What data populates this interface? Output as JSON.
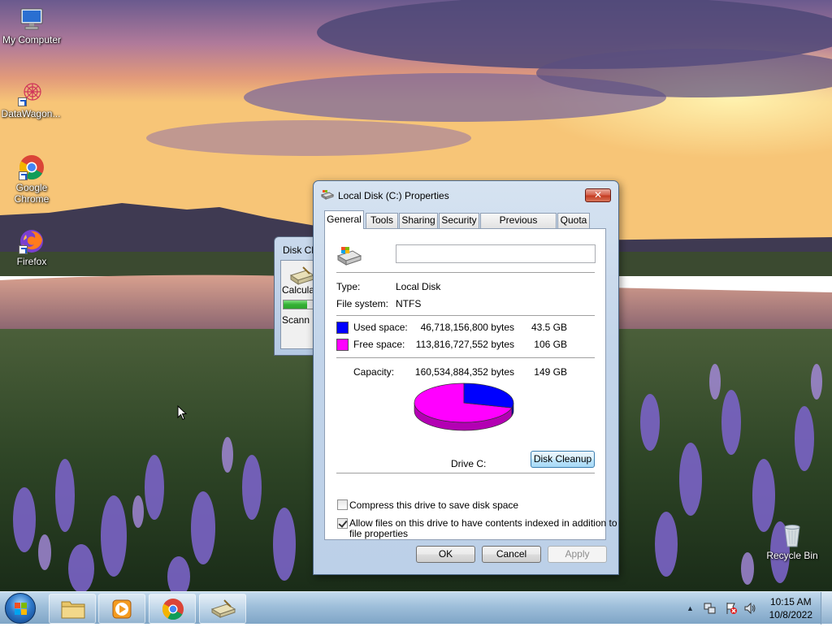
{
  "desktop": {
    "icons": [
      {
        "label": "My Computer"
      },
      {
        "label": "DataWagon..."
      },
      {
        "label": "Google Chrome"
      },
      {
        "label": "Firefox"
      },
      {
        "label": "Recycle Bin"
      }
    ]
  },
  "background_window": {
    "title": "Disk Cl",
    "status": "Calcula",
    "scan": "Scann",
    "progress_percent": 50
  },
  "dialog": {
    "title": "Local Disk (C:) Properties",
    "close_label": "✕",
    "tabs": [
      {
        "label": "General",
        "active": true
      },
      {
        "label": "Tools"
      },
      {
        "label": "Sharing"
      },
      {
        "label": "Security"
      },
      {
        "label": "Previous Versions"
      },
      {
        "label": "Quota"
      }
    ],
    "drive_name_value": "",
    "type_label": "Type:",
    "type_value": "Local Disk",
    "fs_label": "File system:",
    "fs_value": "NTFS",
    "used": {
      "label": "Used space:",
      "bytes": "46,718,156,800 bytes",
      "size": "43.5 GB",
      "color": "#0000ff"
    },
    "free": {
      "label": "Free space:",
      "bytes": "113,816,727,552 bytes",
      "size": "106 GB",
      "color": "#ff00ff"
    },
    "capacity": {
      "label": "Capacity:",
      "bytes": "160,534,884,352 bytes",
      "size": "149 GB"
    },
    "drive_label": "Drive C:",
    "cleanup_button": "Disk Cleanup",
    "compress_label": "Compress this drive to save disk space",
    "compress_checked": false,
    "index_label_line1": "Allow files on this drive to have contents indexed in addition to",
    "index_label_line2": "file properties",
    "index_checked": true,
    "ok_button": "OK",
    "cancel_button": "Cancel",
    "apply_button": "Apply"
  },
  "taskbar": {
    "time": "10:15 AM",
    "date": "10/8/2022",
    "tray_arrow": "▲"
  }
}
